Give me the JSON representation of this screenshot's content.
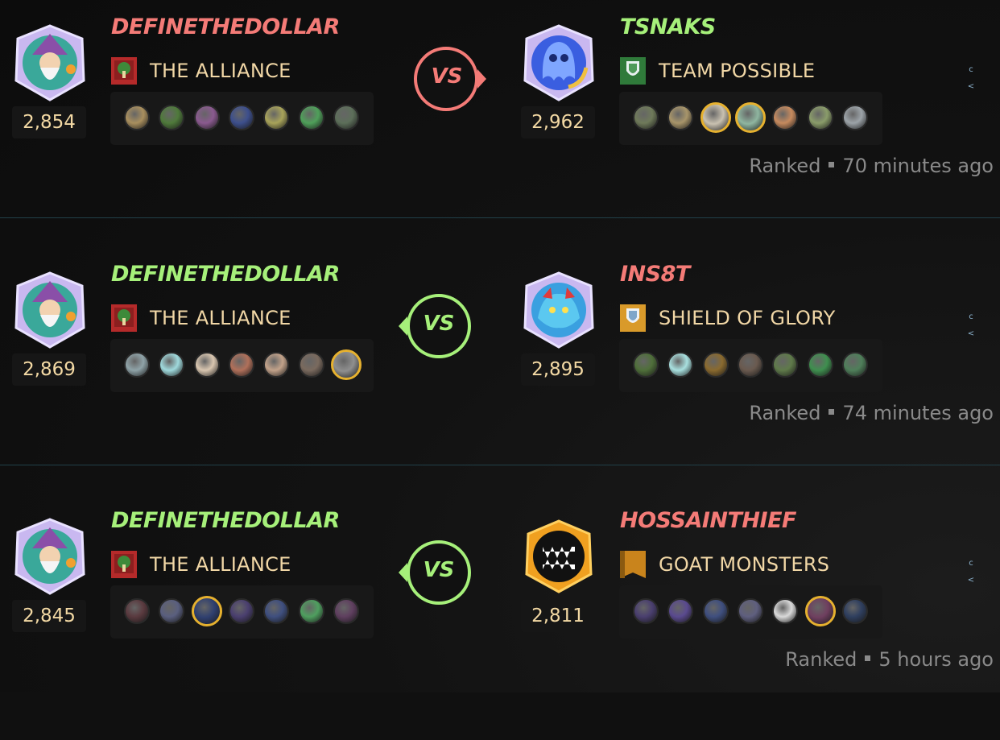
{
  "battles": [
    {
      "left": {
        "name": "DEFINETHEDOLLAR",
        "result": "lose",
        "rating": "2,854",
        "guild": "THE ALLIANCE",
        "guild_icon": "tree-banner-icon",
        "cards": [
          {
            "c": "#a98f5e",
            "gold": false
          },
          {
            "c": "#4f7a3b",
            "gold": false
          },
          {
            "c": "#8a5a8f",
            "gold": false
          },
          {
            "c": "#3d4f8c",
            "gold": false
          },
          {
            "c": "#a8a35a",
            "gold": false
          },
          {
            "c": "#4fa05a",
            "gold": false
          },
          {
            "c": "#5d6f5a",
            "gold": false
          }
        ]
      },
      "right": {
        "name": "TSNAKS",
        "result": "win",
        "rating": "2,962",
        "guild": "TEAM POSSIBLE",
        "guild_icon": "shield-banner-icon",
        "cards": [
          {
            "c": "#6f7a5a",
            "gold": false
          },
          {
            "c": "#a8956a",
            "gold": false
          },
          {
            "c": "#c9c1b0",
            "gold": true
          },
          {
            "c": "#8fb6a0",
            "gold": true
          },
          {
            "c": "#c68a5e",
            "gold": false
          },
          {
            "c": "#8a9c6a",
            "gold": false
          },
          {
            "c": "#9ca3a8",
            "gold": false
          }
        ]
      },
      "vs_label": "VS",
      "winner_side": "right",
      "mode": "Ranked",
      "time": "70 minutes ago"
    },
    {
      "left": {
        "name": "DEFINETHEDOLLAR",
        "result": "win",
        "rating": "2,869",
        "guild": "THE ALLIANCE",
        "guild_icon": "tree-banner-icon",
        "cards": [
          {
            "c": "#8fa3a8",
            "gold": false
          },
          {
            "c": "#9fd9dc",
            "gold": false
          },
          {
            "c": "#d9c6b0",
            "gold": false
          },
          {
            "c": "#b0705a",
            "gold": false
          },
          {
            "c": "#c2a28a",
            "gold": false
          },
          {
            "c": "#7a6a5e",
            "gold": false
          },
          {
            "c": "#8f8f8f",
            "gold": true
          }
        ]
      },
      "right": {
        "name": "INS8T",
        "result": "lose",
        "rating": "2,895",
        "guild": "SHIELD OF GLORY",
        "guild_icon": "gold-shield-banner-icon",
        "cards": [
          {
            "c": "#4f6f3a",
            "gold": false
          },
          {
            "c": "#a8e0df",
            "gold": false
          },
          {
            "c": "#8a6a2f",
            "gold": false
          },
          {
            "c": "#6a5a4f",
            "gold": false
          },
          {
            "c": "#5f7a4a",
            "gold": false
          },
          {
            "c": "#3f8f4f",
            "gold": false
          },
          {
            "c": "#4f7f5a",
            "gold": false
          }
        ]
      },
      "vs_label": "VS",
      "winner_side": "left",
      "mode": "Ranked",
      "time": "74 minutes ago"
    },
    {
      "left": {
        "name": "DEFINETHEDOLLAR",
        "result": "win",
        "rating": "2,845",
        "guild": "THE ALLIANCE",
        "guild_icon": "tree-banner-icon",
        "cards": [
          {
            "c": "#5a3a3f",
            "gold": false
          },
          {
            "c": "#5a5f7f",
            "gold": false
          },
          {
            "c": "#2f3f6f",
            "gold": true
          },
          {
            "c": "#4a3f6f",
            "gold": false
          },
          {
            "c": "#3f4f7f",
            "gold": false
          },
          {
            "c": "#4f9f5f",
            "gold": false
          },
          {
            "c": "#5f3f5f",
            "gold": false
          }
        ]
      },
      "right": {
        "name": "HOSSAINTHIEF",
        "result": "lose",
        "rating": "2,811",
        "guild": "GOAT MONSTERS",
        "guild_icon": "orange-banner-icon",
        "cards": [
          {
            "c": "#4a3f6f",
            "gold": false
          },
          {
            "c": "#5a4a8f",
            "gold": false
          },
          {
            "c": "#3f4f7f",
            "gold": false
          },
          {
            "c": "#5f5f7f",
            "gold": false
          },
          {
            "c": "#d9d9d9",
            "gold": false
          },
          {
            "c": "#6f3f5f",
            "gold": true
          },
          {
            "c": "#2f3f5f",
            "gold": false
          }
        ]
      },
      "vs_label": "VS",
      "winner_side": "left",
      "mode": "Ranked",
      "time": "5 hours ago"
    }
  ],
  "colors": {
    "win": "#a6f07a",
    "lose": "#f47b77",
    "gold_border": "#e6b12f",
    "rating_text": "#f3d9a4",
    "divider": "#214049"
  },
  "side_icons": [
    "c",
    "<"
  ]
}
